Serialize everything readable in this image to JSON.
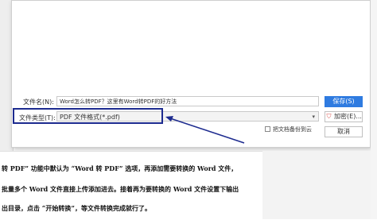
{
  "dialog": {
    "filename_label": "文件名(N):",
    "filename_value": "Word怎么转PDF？这里有Word转PDF的好方法",
    "filetype_label": "文件类型(T):",
    "filetype_value": "PDF 文件格式(*.pdf)",
    "save_button": "保存(S)",
    "encrypt_button": "加密(E)...",
    "cancel_button": "取消",
    "backup_checkbox_label": "把文档备份到云",
    "backup_checked": false
  },
  "document": {
    "lines": [
      "转 PDF” 功能中默认为 “Word 转 PDF” 选项，再添加需要转换的 Word 文件，",
      "批量多个 Word 文件直接上传添加进去。接着再为要转换的 Word 文件设置下输出",
      "出目录，点击 “开始转换”，等文件转换完成就行了。"
    ]
  },
  "colors": {
    "accent": "#2f7be0",
    "highlight": "#1d2b8f"
  }
}
